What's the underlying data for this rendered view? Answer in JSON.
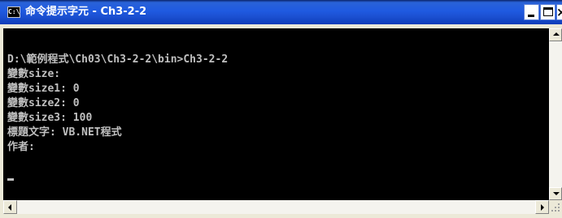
{
  "window": {
    "title": "命令提示字元 - Ch3-2-2",
    "icon": "cmd-icon",
    "icon_text": "C:\\"
  },
  "controls": {
    "minimize_icon": "minimize-icon",
    "maximize_icon": "maximize-icon",
    "close_icon": "close-icon",
    "close_glyph": "×"
  },
  "console": {
    "text_color": "#c0c0c0",
    "background": "#000000",
    "lines": [
      "D:\\範例程式\\Ch03\\Ch3-2-2\\bin>Ch3-2-2",
      "變數size:",
      "變數size1: 0",
      "變數size2: 0",
      "變數size3: 100",
      "標題文字: VB.NET程式",
      "作者:"
    ]
  }
}
